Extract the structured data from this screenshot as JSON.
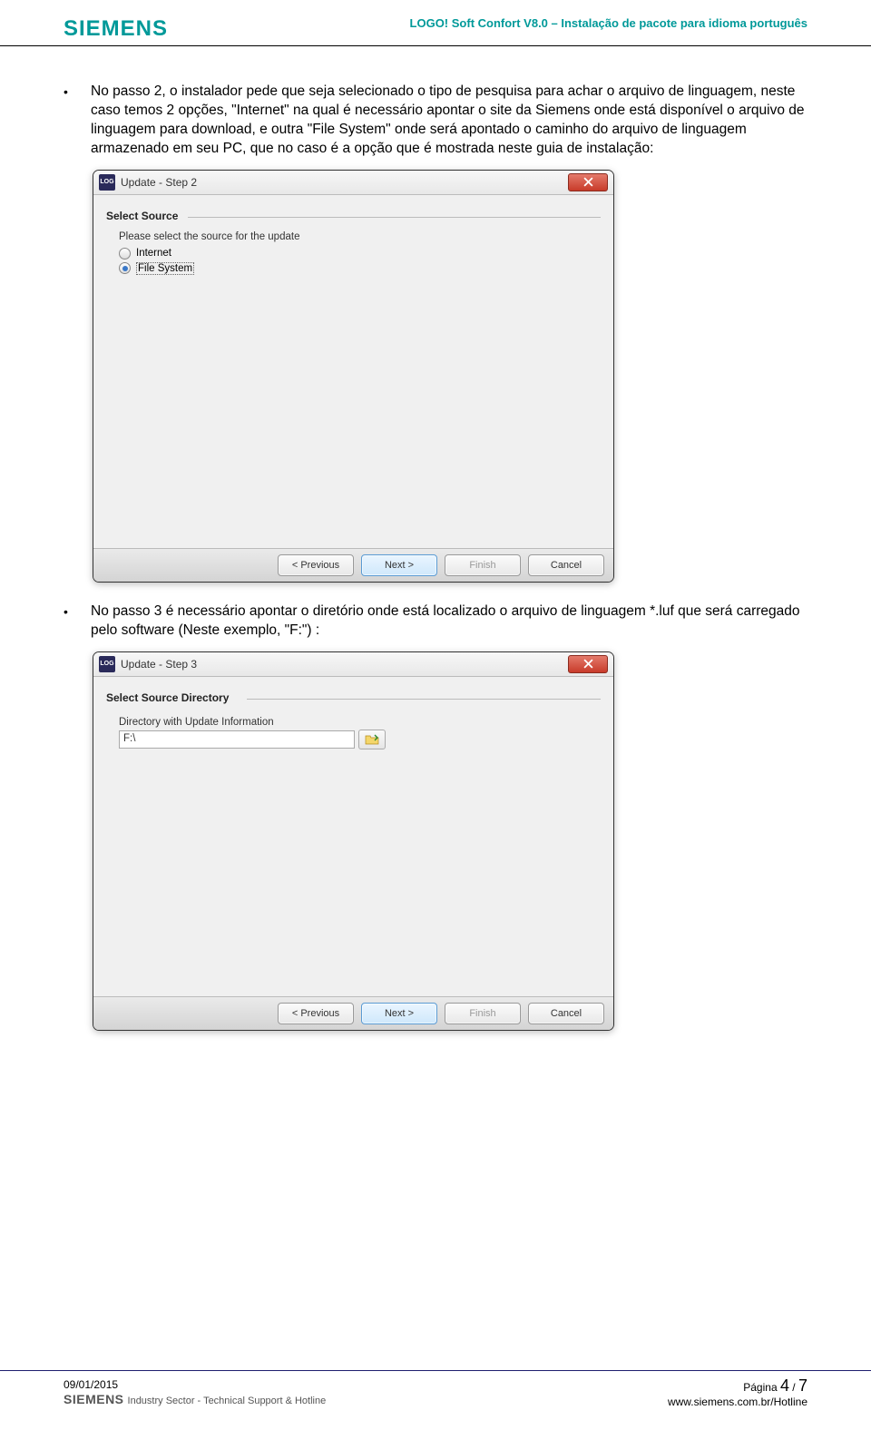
{
  "header": {
    "logo": "SIEMENS",
    "title": "LOGO! Soft Confort V8.0 – Instalação de pacote para idioma português"
  },
  "body": {
    "para1": "No passo 2, o instalador pede que seja selecionado o tipo de pesquisa para achar o arquivo de linguagem, neste caso temos 2 opções, \"Internet\" na qual é necessário apontar o site da Siemens onde está disponível o arquivo de linguagem para download, e outra \"File System\" onde será apontado o caminho do arquivo de linguagem armazenado em seu PC, que no caso é a opção que é mostrada neste guia de instalação:",
    "para2": "No passo 3 é necessário apontar o diretório onde está localizado o arquivo de linguagem *.luf que será carregado pelo software (Neste exemplo, \"F:\") :"
  },
  "dialog1": {
    "title": "Update - Step 2",
    "group": "Select Source",
    "instruction": "Please select the source for the update",
    "option_internet": "Internet",
    "option_filesystem": "File System",
    "buttons": {
      "prev": "< Previous",
      "next": "Next >",
      "finish": "Finish",
      "cancel": "Cancel"
    }
  },
  "dialog2": {
    "title": "Update - Step 3",
    "group": "Select Source Directory",
    "field_label": "Directory with Update Information",
    "field_value": "F:\\",
    "buttons": {
      "prev": "< Previous",
      "next": "Next >",
      "finish": "Finish",
      "cancel": "Cancel"
    }
  },
  "footer": {
    "date": "09/01/2015",
    "co_logo": "SIEMENS",
    "co_text": "Industry Sector  -  Technical Support & Hotline",
    "page_label": "Página ",
    "page_current": "4",
    "page_sep": " / ",
    "page_total": "7",
    "url": "www.siemens.com.br/Hotline"
  }
}
